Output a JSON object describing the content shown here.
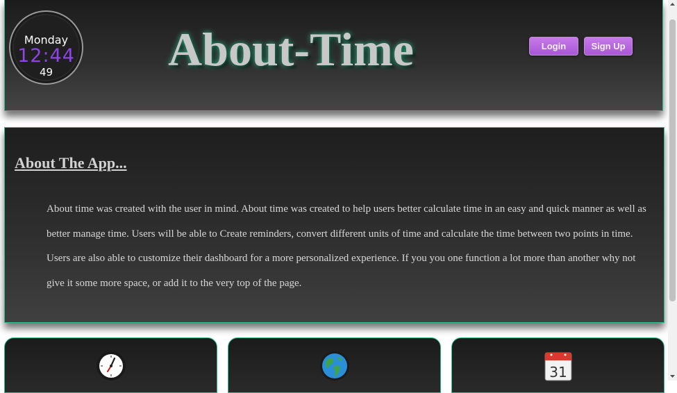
{
  "header": {
    "clock": {
      "day": "Monday",
      "time": "12:44",
      "seconds": "49"
    },
    "brand": "About-Time",
    "login_label": "Login",
    "signup_label": "Sign Up"
  },
  "about": {
    "heading": "About The App...",
    "body": "About time was created with the user in mind. About time was created to help users better calculate time in an easy and quick manner as well as better manage time. Users will be able to Create reminders, convert different units of time and calculate the time between two points in time. Users are also able to customize their dashboard for a more personalized experience. If you you one function a lot more than another why not give it some more space, or add it to the very top of the page."
  },
  "cards": [
    {
      "icon": "clock-icon"
    },
    {
      "icon": "globe-icon"
    },
    {
      "icon": "calendar-icon",
      "calendar_day": "31"
    }
  ],
  "colors": {
    "accent_border": "#2fbf8f",
    "button": "#b767dd",
    "clock_time": "#8e44e6"
  }
}
